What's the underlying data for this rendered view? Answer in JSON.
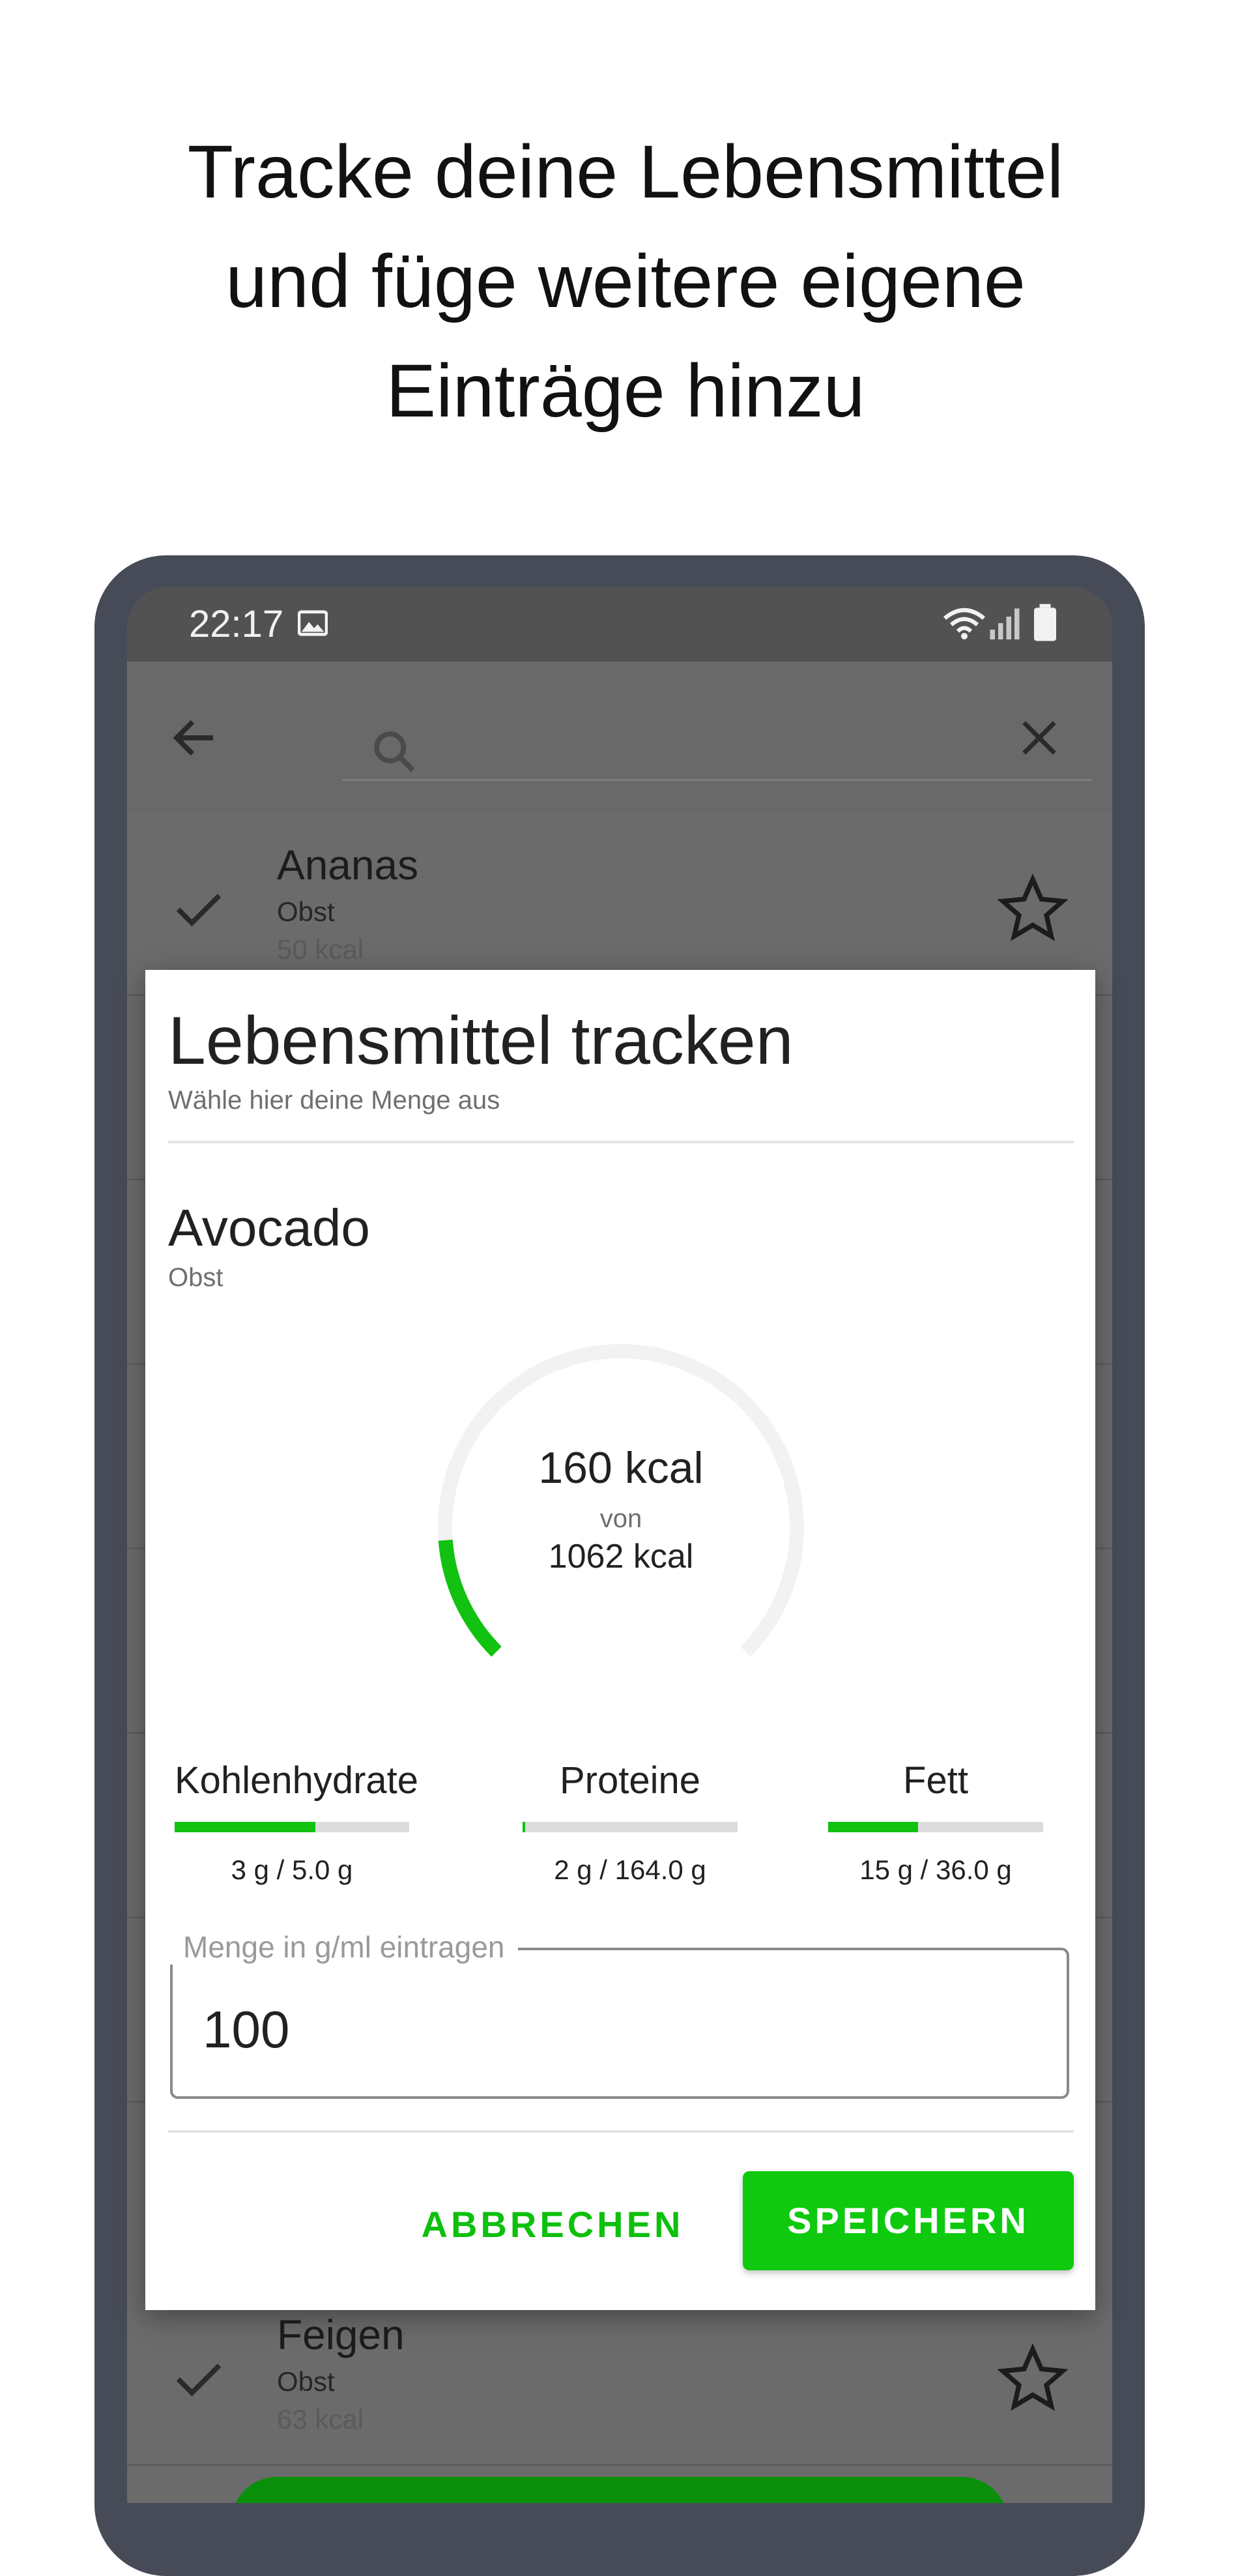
{
  "headline": [
    "Tracke deine Lebensmittel",
    "und füge weitere eigene",
    "Einträge hinzu"
  ],
  "status_bar": {
    "time": "22:17"
  },
  "list": [
    {
      "name": "Ananas",
      "category": "Obst",
      "kcal": "50 kcal"
    },
    {
      "name": "Feigen",
      "category": "Obst",
      "kcal": "63 kcal"
    }
  ],
  "dialog": {
    "title": "Lebensmittel tracken",
    "subtitle": "Wähle hier deine Menge aus",
    "food": {
      "name": "Avocado",
      "category": "Obst"
    },
    "calories": {
      "consumed": "160 kcal",
      "of_label": "von",
      "total": "1062 kcal",
      "fraction": 0.151
    },
    "macros": [
      {
        "label": "Kohlenhydrate",
        "value": "3 g / 5.0 g",
        "fraction": 0.6
      },
      {
        "label": "Proteine",
        "value": "2 g / 164.0 g",
        "fraction": 0.012
      },
      {
        "label": "Fett",
        "value": "15 g / 36.0 g",
        "fraction": 0.417
      }
    ],
    "quantity": {
      "label": "Menge in g/ml eintragen",
      "value": "100"
    },
    "cancel_label": "ABBRECHEN",
    "save_label": "SPEICHERN"
  },
  "colors": {
    "accent": "#0ec90e",
    "device_frame": "#474b57",
    "scrim": "#6b6b6b"
  }
}
